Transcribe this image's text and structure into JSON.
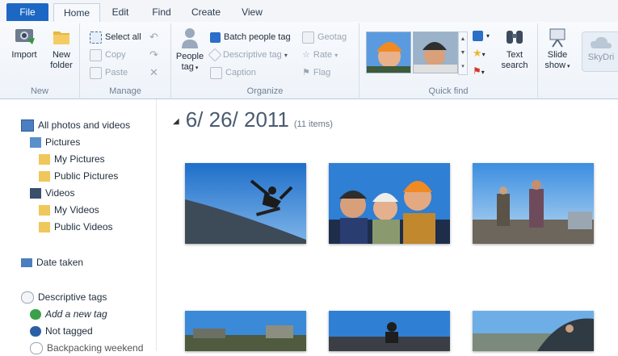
{
  "tabs": {
    "file": "File",
    "home": "Home",
    "edit": "Edit",
    "find": "Find",
    "create": "Create",
    "view": "View"
  },
  "ribbon": {
    "new": {
      "import": "Import",
      "new_folder_1": "New",
      "new_folder_2": "folder",
      "label": "New"
    },
    "manage": {
      "select_all": "Select all",
      "copy": "Copy",
      "paste": "Paste",
      "label": "Manage"
    },
    "organize": {
      "people_tag_1": "People",
      "people_tag_2": "tag",
      "batch_people_tag": "Batch people tag",
      "descriptive_tag": "Descriptive tag",
      "caption": "Caption",
      "geotag": "Geotag",
      "rate": "Rate",
      "flag": "Flag",
      "label": "Organize"
    },
    "quickfind": {
      "text_search_1": "Text",
      "text_search_2": "search",
      "label": "Quick find"
    },
    "share": {
      "slide_show_1": "Slide",
      "slide_show_2": "show",
      "skydrive": "SkyDri"
    }
  },
  "nav": {
    "all_photos": "All photos and videos",
    "pictures": "Pictures",
    "my_pictures": "My Pictures",
    "public_pictures": "Public Pictures",
    "videos": "Videos",
    "my_videos": "My Videos",
    "public_videos": "Public Videos",
    "date_taken": "Date taken",
    "descriptive_tags": "Descriptive tags",
    "add_new_tag": "Add a new tag",
    "not_tagged": "Not tagged",
    "partial": "Backpacking weekend"
  },
  "content": {
    "date": "6/ 26/ 2011",
    "count": "(11 items)"
  },
  "colors": {
    "file_tab": "#1c67c4",
    "sky": "#3a8fd6",
    "accent": "#2a6fc9"
  }
}
